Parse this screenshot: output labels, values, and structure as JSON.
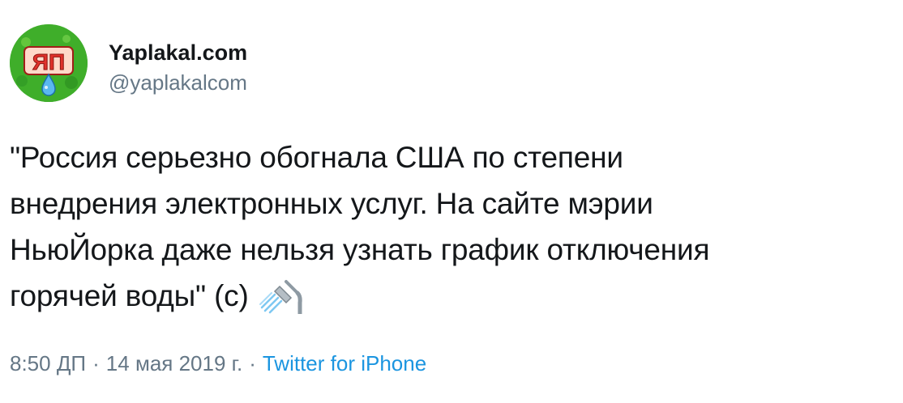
{
  "tweet": {
    "author": {
      "display_name": "Yaplakal.com",
      "handle": "@yaplakalcom",
      "avatar_text": "ЯП",
      "avatar_icon": "yaplakal-logo"
    },
    "text_lines": [
      "\"Россия серьезно обогнала США по степени",
      "внедрения электронных услуг. На сайте мэрии",
      "НьюЙорка даже нельзя узнать график отключения",
      "горячей воды\" (с)"
    ],
    "emoji": "shower-icon",
    "time": "8:50 ДП",
    "separator": "·",
    "date": "14 мая 2019 г.",
    "source": "Twitter for iPhone"
  },
  "colors": {
    "text": "#14171a",
    "muted": "#657786",
    "link": "#1b95e0",
    "avatar_green": "#3fae2a",
    "logo_red": "#e0322b",
    "drop_blue": "#5ab8f0"
  }
}
